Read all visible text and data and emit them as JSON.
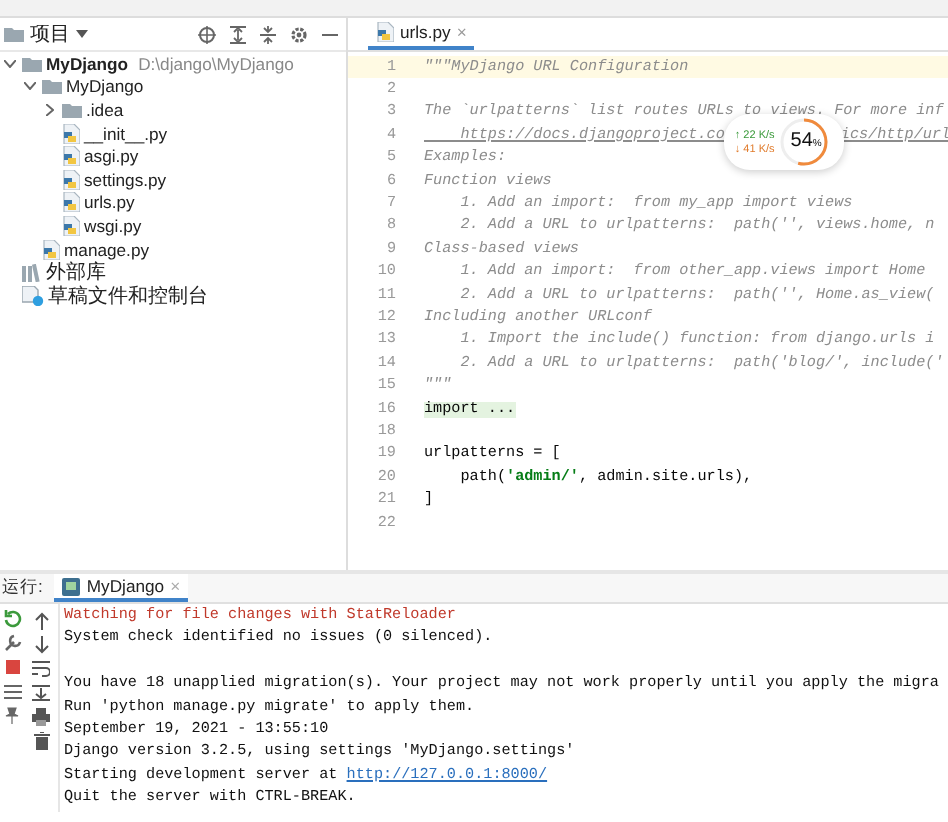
{
  "project": {
    "title": "项目",
    "tree": [
      {
        "label": "MyDjango",
        "path": "D:\\django\\MyDjango",
        "kind": "folder",
        "expanded": true,
        "children": [
          {
            "label": "MyDjango",
            "kind": "folder",
            "expanded": true,
            "children": [
              {
                "label": ".idea",
                "kind": "folder",
                "expanded": false
              },
              {
                "label": "__init__.py",
                "kind": "python"
              },
              {
                "label": "asgi.py",
                "kind": "python"
              },
              {
                "label": "settings.py",
                "kind": "python"
              },
              {
                "label": "urls.py",
                "kind": "python"
              },
              {
                "label": "wsgi.py",
                "kind": "python"
              }
            ]
          },
          {
            "label": "manage.py",
            "kind": "python"
          }
        ]
      },
      {
        "label": "外部库",
        "kind": "library"
      },
      {
        "label": "草稿文件和控制台",
        "kind": "scratch"
      }
    ]
  },
  "editor": {
    "tabs": [
      {
        "label": "urls.py",
        "close": "×",
        "selected": true
      }
    ],
    "lines": [
      {
        "number": "1",
        "segments": [
          {
            "kind": "doc",
            "text": "\"\"\"MyDjango URL Configuration"
          }
        ]
      },
      {
        "number": "2"
      },
      {
        "number": "3",
        "segments": [
          {
            "kind": "doc",
            "text": "The `urlpatterns` list routes URLs to views. For more inf"
          }
        ]
      },
      {
        "number": "4",
        "kind": "widget_gap",
        "segments": [
          {
            "kind": "link",
            "text": "    https://docs.djangoproject.co"
          },
          {
            "kind": "link",
            "text": "ics/http/url"
          }
        ]
      },
      {
        "number": "5",
        "segments": [
          {
            "kind": "doc",
            "text": "Examples:"
          }
        ]
      },
      {
        "number": "6",
        "segments": [
          {
            "kind": "doc",
            "text": "Function views"
          }
        ]
      },
      {
        "number": "7",
        "segments": [
          {
            "kind": "doc",
            "text": "    1. Add an import:  from my_app import views"
          }
        ]
      },
      {
        "number": "8",
        "segments": [
          {
            "kind": "doc",
            "text": "    2. Add a URL to urlpatterns:  path('', views.home, n"
          }
        ]
      },
      {
        "number": "9",
        "segments": [
          {
            "kind": "doc",
            "text": "Class-based views"
          }
        ]
      },
      {
        "number": "10",
        "segments": [
          {
            "kind": "doc",
            "text": "    1. Add an import:  from other_app.views import Home"
          }
        ]
      },
      {
        "number": "11",
        "segments": [
          {
            "kind": "doc",
            "text": "    2. Add a URL to urlpatterns:  path('', Home.as_view("
          }
        ]
      },
      {
        "number": "12",
        "segments": [
          {
            "kind": "doc",
            "text": "Including another URLconf"
          }
        ]
      },
      {
        "number": "13",
        "segments": [
          {
            "kind": "doc",
            "text": "    1. Import the include() function: from django.urls i"
          }
        ]
      },
      {
        "number": "14",
        "segments": [
          {
            "kind": "doc",
            "text": "    2. Add a URL to urlpatterns:  path('blog/', include('"
          }
        ]
      },
      {
        "number": "15",
        "segments": [
          {
            "kind": "doc",
            "text": "\"\"\""
          }
        ]
      },
      {
        "number": "16",
        "segments": [
          {
            "kind": "fold",
            "text": "import ..."
          }
        ]
      },
      {
        "number": "18"
      },
      {
        "number": "19",
        "segments": [
          {
            "kind": "code",
            "text": "urlpatterns = ["
          }
        ]
      },
      {
        "number": "20",
        "segments": [
          {
            "kind": "code",
            "text": "    path("
          },
          {
            "kind": "string",
            "text": "'admin/'"
          },
          {
            "kind": "code",
            "text": ", admin.site.urls),"
          }
        ]
      },
      {
        "number": "21",
        "segments": [
          {
            "kind": "code",
            "text": "]"
          }
        ]
      },
      {
        "number": "22"
      }
    ]
  },
  "network_widget": {
    "upload": "↑ 22 K/s",
    "download": "↓ 41 K/s",
    "percent": "54",
    "unit": "%",
    "level": 0.54
  },
  "run": {
    "label": "运行:",
    "tabs": [
      {
        "label": "MyDjango",
        "close": "×",
        "selected": true
      }
    ],
    "console": [
      {
        "kind": "error",
        "text": "Watching for file changes with StatReloader"
      },
      {
        "kind": "normal",
        "text": "System check identified no issues (0 silenced)."
      },
      {
        "kind": "blank"
      },
      {
        "kind": "normal",
        "text": "You have 18 unapplied migration(s). Your project may not work properly until you apply the migra"
      },
      {
        "kind": "normal",
        "text": "Run 'python manage.py migrate' to apply them."
      },
      {
        "kind": "normal",
        "text": "September 19, 2021 - 13:55:10"
      },
      {
        "kind": "normal",
        "text": "Django version 3.2.5, using settings 'MyDjango.settings'"
      },
      {
        "kind": "normal",
        "text": "Starting development server at ",
        "link": "http://127.0.0.1:8000/"
      },
      {
        "kind": "normal",
        "text": "Quit the server with CTRL-BREAK."
      }
    ]
  }
}
